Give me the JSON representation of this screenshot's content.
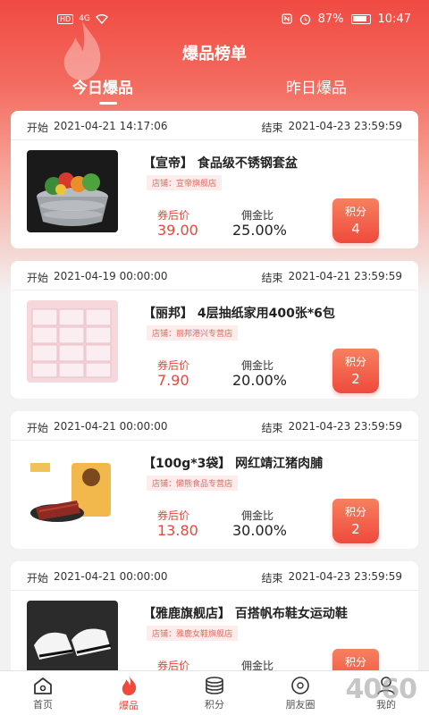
{
  "status_bar": {
    "network": "4G",
    "hd": "HD",
    "battery": "87%",
    "time": "10:47"
  },
  "header": {
    "title": "爆品榜单"
  },
  "tabs": [
    {
      "label": "今日爆品",
      "active": true
    },
    {
      "label": "昨日爆品",
      "active": false
    }
  ],
  "cards": [
    {
      "start_label": "开始",
      "start": "2021-04-21 14:17:06",
      "end_label": "结束",
      "end": "2021-04-23 23:59:59",
      "title": "【宣帝】 食品级不锈钢套盆",
      "shop": "店铺：宣帝旗舰店",
      "price_label": "券后价",
      "price": "39.00",
      "commission_label": "佣金比",
      "commission": "25.00%",
      "points_label": "积分",
      "points": "4"
    },
    {
      "start_label": "开始",
      "start": "2021-04-19 00:00:00",
      "end_label": "结束",
      "end": "2021-04-21 23:59:59",
      "title": "【丽邦】 4层抽纸家用400张*6包",
      "shop": "店铺：丽邦港兴专营店",
      "price_label": "券后价",
      "price": "7.90",
      "commission_label": "佣金比",
      "commission": "20.00%",
      "points_label": "积分",
      "points": "2"
    },
    {
      "start_label": "开始",
      "start": "2021-04-21 00:00:00",
      "end_label": "结束",
      "end": "2021-04-23 23:59:59",
      "title": "【100g*3袋】 网红靖江猪肉脯",
      "shop": "店铺：懒熊食品专营店",
      "price_label": "券后价",
      "price": "13.80",
      "commission_label": "佣金比",
      "commission": "30.00%",
      "points_label": "积分",
      "points": "2"
    },
    {
      "start_label": "开始",
      "start": "2021-04-21 00:00:00",
      "end_label": "结束",
      "end": "2021-04-23 23:59:59",
      "title": "【雅鹿旗舰店】 百搭帆布鞋女运动鞋",
      "shop": "店铺：雅鹿女鞋旗舰店",
      "price_label": "券后价",
      "price": "",
      "commission_label": "佣金比",
      "commission": "",
      "points_label": "积分",
      "points": ""
    }
  ],
  "bottom_nav": [
    {
      "label": "首页",
      "icon": "home-icon",
      "active": false
    },
    {
      "label": "爆品",
      "icon": "flame-icon",
      "active": true
    },
    {
      "label": "积分",
      "icon": "coins-icon",
      "active": false
    },
    {
      "label": "朋友圈",
      "icon": "moments-icon",
      "active": false
    },
    {
      "label": "我的",
      "icon": "user-icon",
      "active": false
    }
  ],
  "watermark": "4060",
  "colors": {
    "brand": "#ef4a3c",
    "price": "#e8473c"
  }
}
